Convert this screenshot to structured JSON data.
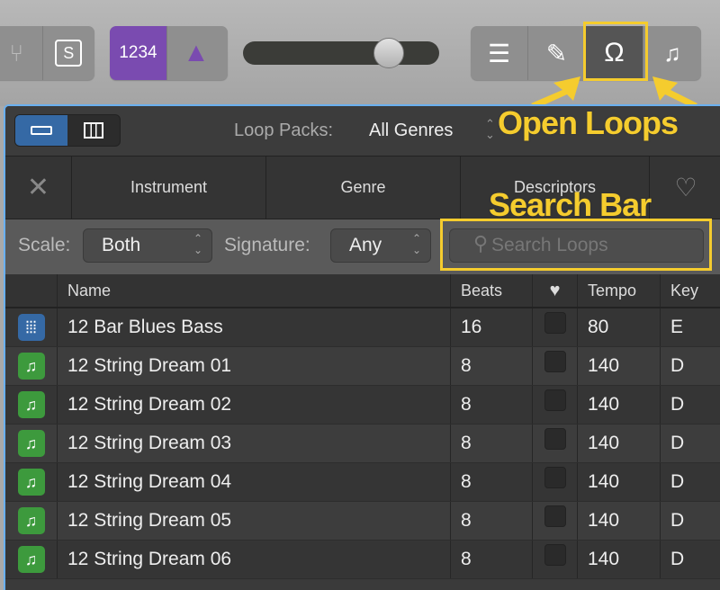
{
  "toolbar": {
    "solo_label": "S",
    "count_in_label": "1234",
    "accent": "#7a4bb0"
  },
  "loop_browser": {
    "loop_packs_label": "Loop Packs:",
    "loop_packs_value": "All Genres",
    "filter_tabs": [
      "Instrument",
      "Genre",
      "Descriptors"
    ],
    "scale_label": "Scale:",
    "scale_value": "Both",
    "signature_label": "Signature:",
    "signature_value": "Any",
    "search_placeholder": "Search Loops",
    "columns": {
      "name": "Name",
      "beats": "Beats",
      "tempo": "Tempo",
      "key": "Key"
    },
    "rows": [
      {
        "type": "audio",
        "name": "12 Bar Blues Bass",
        "beats": "16",
        "tempo": "80",
        "key": "E"
      },
      {
        "type": "midi",
        "name": "12 String Dream 01",
        "beats": "8",
        "tempo": "140",
        "key": "D"
      },
      {
        "type": "midi",
        "name": "12 String Dream 02",
        "beats": "8",
        "tempo": "140",
        "key": "D"
      },
      {
        "type": "midi",
        "name": "12 String Dream 03",
        "beats": "8",
        "tempo": "140",
        "key": "D"
      },
      {
        "type": "midi",
        "name": "12 String Dream 04",
        "beats": "8",
        "tempo": "140",
        "key": "D"
      },
      {
        "type": "midi",
        "name": "12 String Dream 05",
        "beats": "8",
        "tempo": "140",
        "key": "D"
      },
      {
        "type": "midi",
        "name": "12 String Dream 06",
        "beats": "8",
        "tempo": "140",
        "key": "D"
      }
    ]
  },
  "annotations": {
    "open_loops": "Open Loops",
    "search_bar": "Search Bar",
    "color": "#f5cc2e"
  }
}
